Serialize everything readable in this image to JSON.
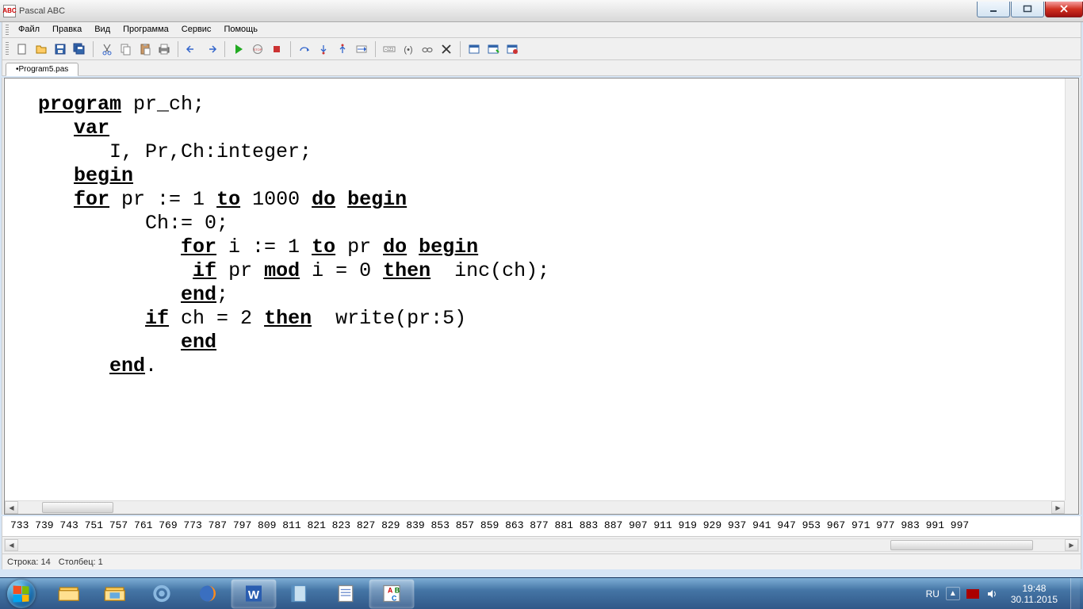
{
  "titlebar": {
    "title": "Pascal ABC",
    "app_icon_text": "ABC"
  },
  "menu": {
    "items": [
      "Файл",
      "Правка",
      "Вид",
      "Программа",
      "Сервис",
      "Помощь"
    ]
  },
  "tabs": {
    "active": "•Program5.pas"
  },
  "code": {
    "lines": [
      {
        "indent": 0,
        "parts": [
          {
            "t": "program",
            "kw": true
          },
          {
            "t": " pr_ch;"
          }
        ]
      },
      {
        "indent": 1,
        "parts": [
          {
            "t": "var",
            "kw": true
          }
        ]
      },
      {
        "indent": 2,
        "parts": [
          {
            "t": "I, Pr,Ch:integer;"
          }
        ]
      },
      {
        "indent": 1,
        "parts": [
          {
            "t": "begin",
            "kw": true
          }
        ]
      },
      {
        "indent": 1,
        "parts": [
          {
            "t": "for",
            "kw": true
          },
          {
            "t": " pr := 1 "
          },
          {
            "t": "to",
            "kw": true
          },
          {
            "t": " 1000 "
          },
          {
            "t": "do",
            "kw": true
          },
          {
            "t": " "
          },
          {
            "t": "begin",
            "kw": true
          }
        ]
      },
      {
        "indent": 3,
        "parts": [
          {
            "t": "Ch:= 0;"
          }
        ]
      },
      {
        "indent": 4,
        "parts": [
          {
            "t": "for",
            "kw": true
          },
          {
            "t": " i := 1 "
          },
          {
            "t": "to",
            "kw": true
          },
          {
            "t": " pr "
          },
          {
            "t": "do",
            "kw": true
          },
          {
            "t": " "
          },
          {
            "t": "begin",
            "kw": true
          }
        ]
      },
      {
        "indent": 4,
        "parts": [
          {
            "t": " "
          },
          {
            "t": "if",
            "kw": true
          },
          {
            "t": " pr "
          },
          {
            "t": "mod",
            "kw": true
          },
          {
            "t": " i = 0 "
          },
          {
            "t": "then",
            "kw": true
          },
          {
            "t": "  inc(ch);"
          }
        ]
      },
      {
        "indent": 4,
        "parts": [
          {
            "t": "end",
            "kw": true
          },
          {
            "t": ";"
          }
        ]
      },
      {
        "indent": 3,
        "parts": [
          {
            "t": "if",
            "kw": true
          },
          {
            "t": " ch = 2 "
          },
          {
            "t": "then",
            "kw": true
          },
          {
            "t": "  write(pr:5)"
          }
        ]
      },
      {
        "indent": 4,
        "parts": [
          {
            "t": "end",
            "kw": true
          }
        ]
      },
      {
        "indent": 2,
        "parts": [
          {
            "t": "end",
            "kw": true
          },
          {
            "t": "."
          }
        ]
      }
    ]
  },
  "output": "733  739  743  751  757  761  769  773  787  797  809  811  821  823  827  829  839  853  857  859  863  877  881  883  887  907  911  919  929  937  941  947  953  967  971  977  983  991  997",
  "status": {
    "line_label": "Строка: 14",
    "col_label": "Столбец: 1"
  },
  "tray": {
    "lang": "RU",
    "time": "19:48",
    "date": "30.11.2015"
  },
  "toolbar_icons": [
    "new",
    "open",
    "save",
    "save-all",
    "cut",
    "copy",
    "paste",
    "print",
    "undo",
    "redo",
    "run",
    "pause",
    "stop",
    "step-over",
    "step-into",
    "step-out",
    "trace",
    "goto-cursor",
    "breakpoint",
    "watch",
    "eval",
    "stop-eval",
    "form-new",
    "form-run",
    "form-edit"
  ],
  "taskbar_apps": [
    "explorer",
    "folder",
    "gear",
    "firefox",
    "word",
    "onenote",
    "notepad",
    "pascal"
  ]
}
